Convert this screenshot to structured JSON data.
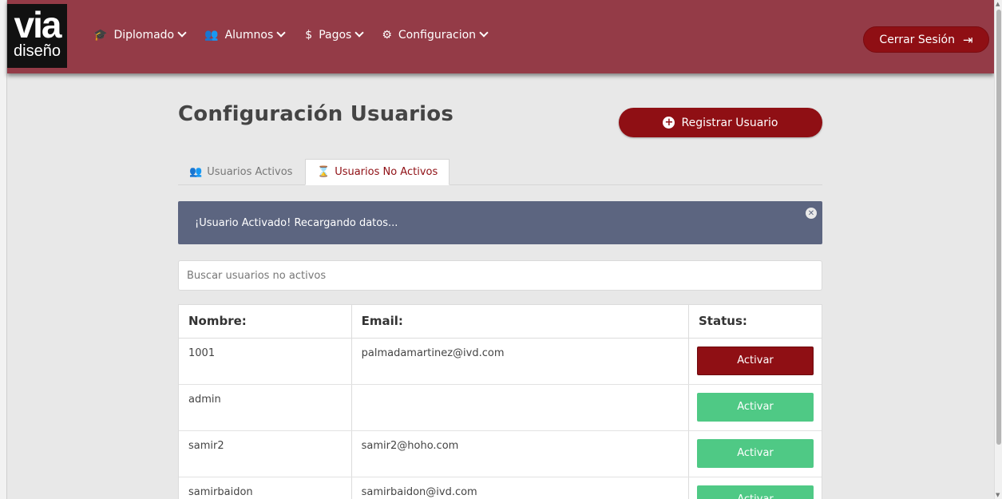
{
  "navbar": {
    "logo_top": "via",
    "logo_bottom": "diseño",
    "menu": [
      {
        "label": "Diplomado",
        "icon": "graduation-cap-icon"
      },
      {
        "label": "Alumnos",
        "icon": "users-icon"
      },
      {
        "label": "Pagos",
        "icon": "dollar-icon"
      },
      {
        "label": "Configuracion",
        "icon": "cog-icon"
      }
    ],
    "logout_label": "Cerrar Sesión"
  },
  "page": {
    "title": "Configuración Usuarios",
    "register_label": "Registrar Usuario"
  },
  "tabs": [
    {
      "label": "Usuarios Activos",
      "active": false
    },
    {
      "label": "Usuarios No Activos",
      "active": true
    }
  ],
  "alert": {
    "message": "¡Usuario Activado! Recargando datos..."
  },
  "search": {
    "placeholder": "Buscar usuarios no activos",
    "value": ""
  },
  "table": {
    "headers": [
      "Nombre:",
      "Email:",
      "Status:"
    ],
    "rows": [
      {
        "name": "1001",
        "email": "palmadamartinez@ivd.com",
        "status_label": "Activar",
        "button_color": "#8f0f14"
      },
      {
        "name": "admin",
        "email": "",
        "status_label": "Activar",
        "button_color": "#4fc985"
      },
      {
        "name": "samir2",
        "email": "samir2@hoho.com",
        "status_label": "Activar",
        "button_color": "#4fc985"
      },
      {
        "name": "samirbaidon",
        "email": "samirbaidon@ivd.com",
        "status_label": "Activar",
        "button_color": "#4fc985"
      }
    ]
  },
  "colors": {
    "navbar": "#943b47",
    "primary": "#8f0f14",
    "alert": "#5c6580",
    "success": "#4fc985"
  }
}
